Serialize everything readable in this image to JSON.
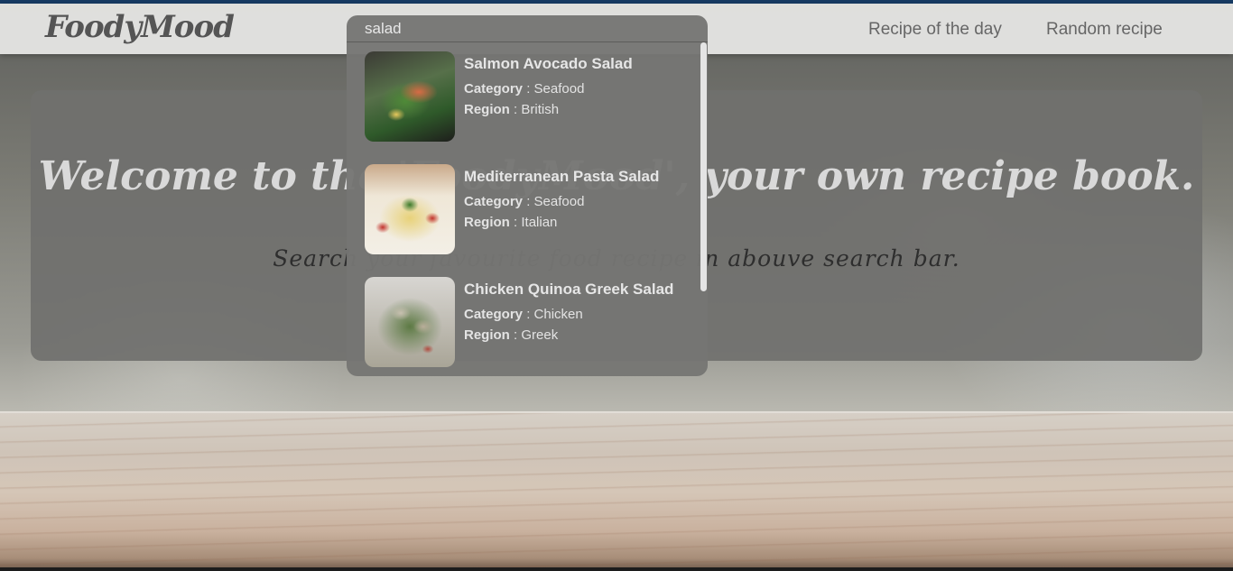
{
  "header": {
    "logo": "FoodyMood",
    "nav": [
      {
        "label": "Recipe of the day"
      },
      {
        "label": "Random recipe"
      }
    ]
  },
  "hero": {
    "title": "Welcome to the 'FoodyMood', your own recipe book.",
    "subtitle": "Search your favourite food recipe in abouve search bar."
  },
  "search": {
    "value": "salad",
    "category_label": "Category",
    "region_label": "Region",
    "results": [
      {
        "name": "Salmon Avocado Salad",
        "category": "Seafood",
        "region": "British"
      },
      {
        "name": "Mediterranean Pasta Salad",
        "category": "Seafood",
        "region": "Italian"
      },
      {
        "name": "Chicken Quinoa Greek Salad",
        "category": "Chicken",
        "region": "Greek"
      }
    ]
  },
  "icons": [
    "salmon-salad-image",
    "pasta-salad-image",
    "quinoa-salad-image"
  ]
}
